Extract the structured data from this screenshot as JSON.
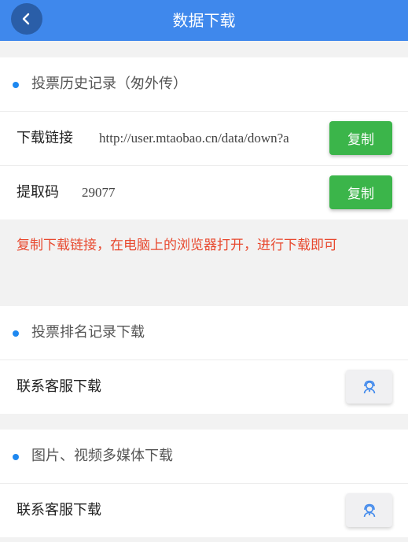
{
  "header": {
    "title": "数据下载",
    "back_icon": "chevron-left-icon"
  },
  "history": {
    "title": "投票历史记录（匆外传）",
    "link_label": "下载链接",
    "link_value": "http://user.mtaobao.cn/data/down?a",
    "code_label": "提取码",
    "code_value": "29077",
    "copy_label": "复制"
  },
  "notice": {
    "text": "复制下载链接，在电脑上的浏览器打开，进行下载即可"
  },
  "ranking": {
    "title": "投票排名记录下载",
    "contact_label": "联系客服下载",
    "icon": "customer-service-icon"
  },
  "media": {
    "title": "图片、视频多媒体下载",
    "contact_label": "联系客服下载",
    "icon": "customer-service-icon"
  },
  "colors": {
    "header_bg": "#3f88ec",
    "copy_btn": "#3bb54a",
    "notice_text": "#e8492f",
    "bullet": "#1e88f0"
  }
}
